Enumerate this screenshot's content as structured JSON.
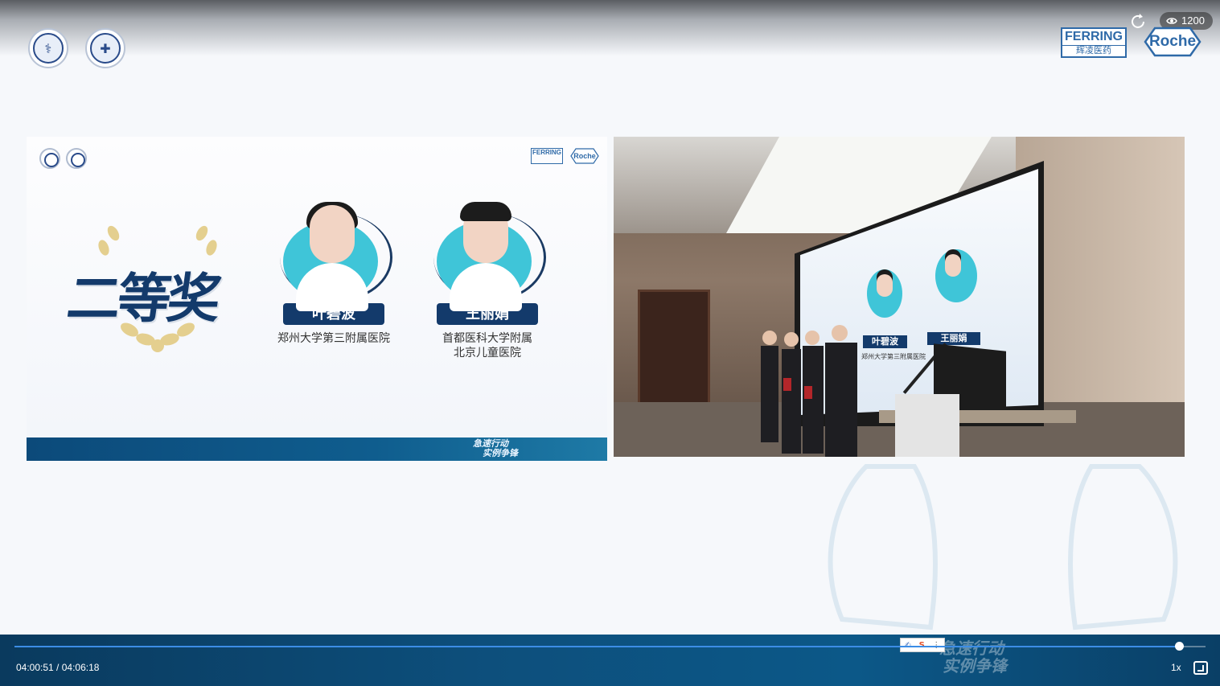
{
  "header": {
    "viewer_count": "1200",
    "sponsor_ferring_en": "FERRING",
    "sponsor_ferring_cn": "辉凌医药",
    "sponsor_roche": "Roche"
  },
  "slide": {
    "ferring_small": "FERRING",
    "roche_small": "Roche",
    "award_title": "二等奖",
    "people": [
      {
        "name": "叶碧波",
        "hospital": "郑州大学第三附属医院"
      },
      {
        "name": "王丽娟",
        "hospital_line1": "首都医科大学附属",
        "hospital_line2": "北京儿童医院"
      }
    ],
    "footer_brand_line1": "急速行动",
    "footer_brand_line2": "实例争锋"
  },
  "photo": {
    "screen_name_1": "叶碧波",
    "screen_hosp_1": "郑州大学第三附属医院",
    "screen_name_2": "王丽娟"
  },
  "player": {
    "current_time": "04:00:51",
    "separator": " / ",
    "total_time": "04:06:18",
    "progress": 0.9777,
    "speed": "1x",
    "brand_line1": "急速行动",
    "brand_line2": "实例争锋"
  },
  "colors": {
    "navy": "#133a6b",
    "teal": "#3fc5d8",
    "progress": "#3c8de6"
  }
}
